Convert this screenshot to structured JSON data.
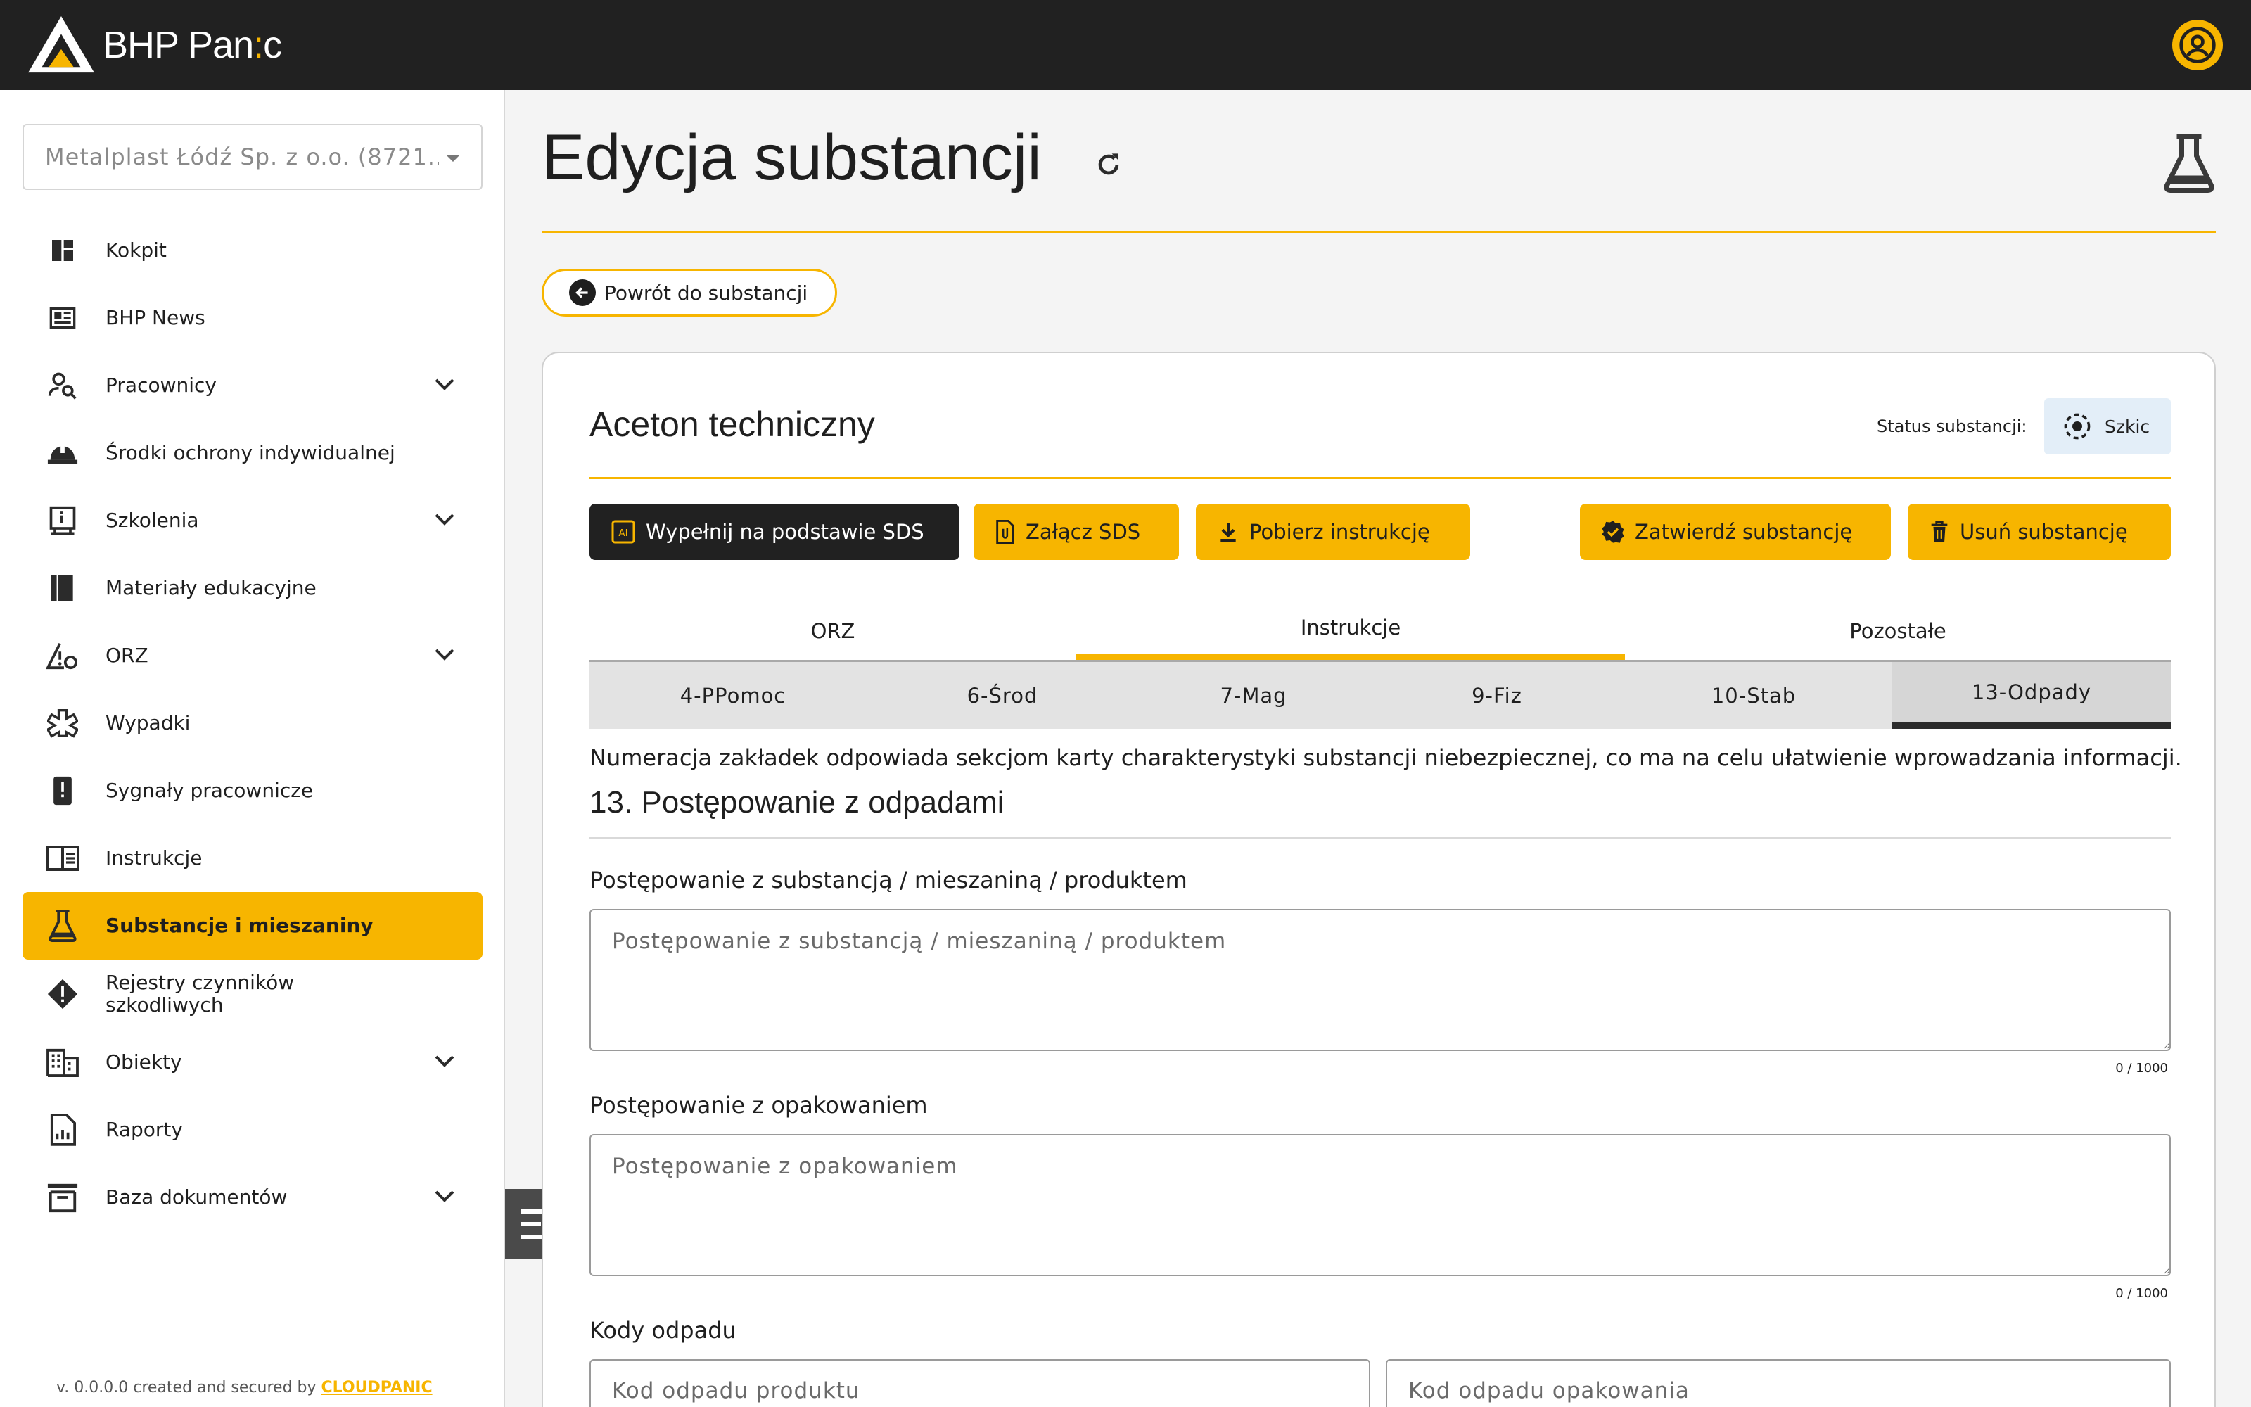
{
  "app": {
    "logo_text": "BHP Pan",
    "logo_colon": ":",
    "logo_tail": "c"
  },
  "sidebar": {
    "company": "Metalplast Łódź Sp. z o.o. (8721...",
    "items": [
      {
        "label": "Kokpit",
        "icon": "dashboard-icon"
      },
      {
        "label": "BHP News",
        "icon": "news-icon"
      },
      {
        "label": "Pracownicy",
        "icon": "person-search-icon",
        "expandable": true
      },
      {
        "label": "Środki ochrony indywidualnej",
        "icon": "helmet-icon"
      },
      {
        "label": "Szkolenia",
        "icon": "training-icon",
        "expandable": true
      },
      {
        "label": "Materiały edukacyjne",
        "icon": "book-icon"
      },
      {
        "label": "ORZ",
        "icon": "risk-icon",
        "expandable": true
      },
      {
        "label": "Wypadki",
        "icon": "medical-icon"
      },
      {
        "label": "Sygnały pracownicze",
        "icon": "alert-phone-icon"
      },
      {
        "label": "Instrukcje",
        "icon": "manual-icon"
      },
      {
        "label": "Substancje i mieszaniny",
        "icon": "flask-icon",
        "active": true
      },
      {
        "label": "Rejestry czynników szkodliwych",
        "icon": "warning-icon"
      },
      {
        "label": "Obiekty",
        "icon": "building-icon",
        "expandable": true
      },
      {
        "label": "Raporty",
        "icon": "report-icon"
      },
      {
        "label": "Baza dokumentów",
        "icon": "archive-icon",
        "expandable": true
      }
    ],
    "version_text": "v. 0.0.0.0 created and secured by ",
    "version_brand": "CLOUDPANIC"
  },
  "page": {
    "title": "Edycja substancji",
    "back_label": "Powrót do substancji"
  },
  "card": {
    "substance_name": "Aceton techniczny",
    "status_label": "Status substancji:",
    "status_value": "Szkic",
    "buttons": {
      "fill_sds": "Wypełnij na podstawie SDS",
      "attach_sds": "Załącz SDS",
      "download": "Pobierz instrukcję",
      "approve": "Zatwierdź substancję",
      "delete": "Usuń substancję"
    },
    "tabs": [
      "ORZ",
      "Instrukcje",
      "Pozostałe"
    ],
    "subtabs": [
      "4-PPomoc",
      "6-Środ",
      "7-Mag",
      "9-Fiz",
      "10-Stab",
      "13-Odpady"
    ],
    "note": "Numeracja zakładek odpowiada sekcjom karty charakterystyki substancji niebezpiecznej, co ma na celu ułatwienie wprowadzania informacji.",
    "section_title": "13. Postępowanie z odpadami",
    "fields": {
      "substance_label": "Postępowanie z substancją / mieszaniną / produktem",
      "substance_placeholder": "Postępowanie z substancją / mieszaniną / produktem",
      "substance_counter": "0 / 1000",
      "packaging_label": "Postępowanie z opakowaniem",
      "packaging_placeholder": "Postępowanie z opakowaniem",
      "packaging_counter": "0 / 1000",
      "codes_label": "Kody odpadu",
      "product_code_placeholder": "Kod odpadu produktu",
      "packaging_code_placeholder": "Kod odpadu opakowania"
    }
  },
  "colors": {
    "accent": "#f7b500",
    "topbar": "#212121",
    "status_bg": "#e3eef8"
  }
}
